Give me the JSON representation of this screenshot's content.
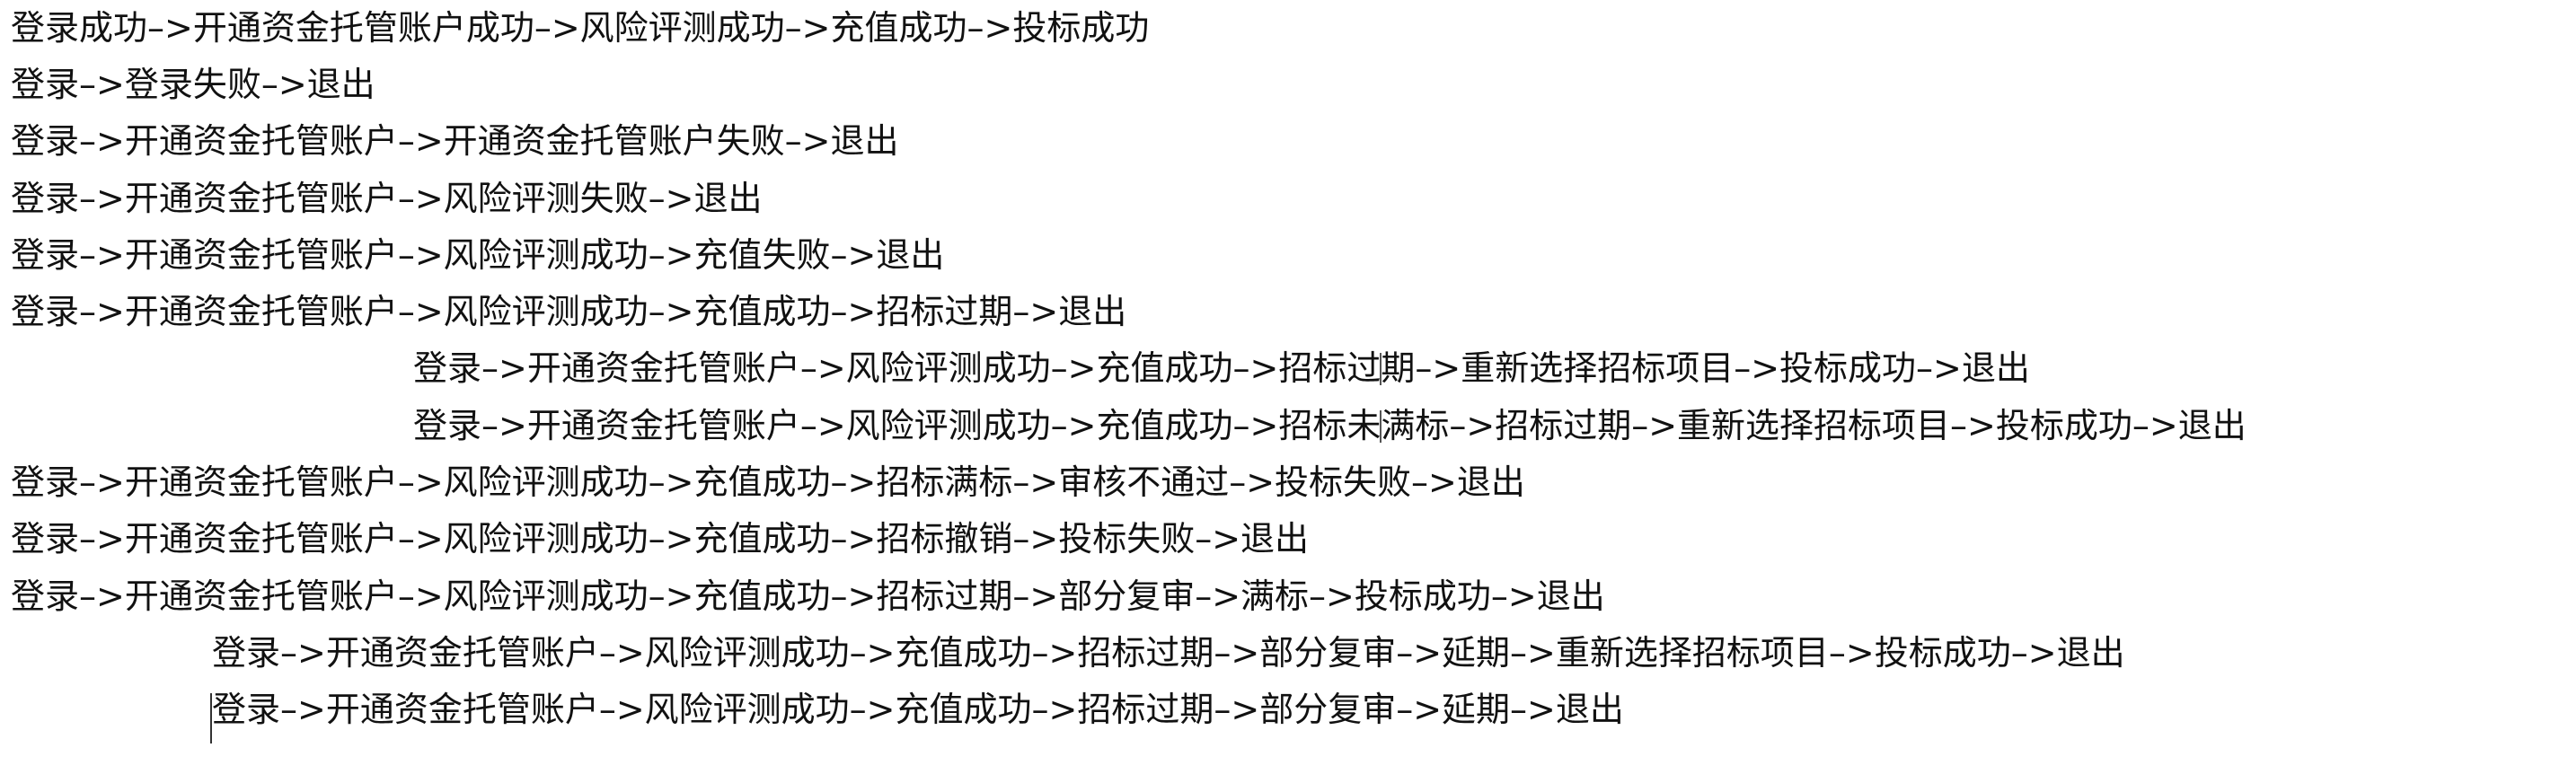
{
  "lines": [
    "登录成功–>开通资金托管账户成功–>风险评测成功–>充值成功–>投标成功",
    "登录–>登录失败–>退出",
    "登录–>开通资金托管账户–>开通资金托管账户失败–>退出",
    "登录–>开通资金托管账户–>风险评测失败–>退出",
    "登录–>开通资金托管账户–>风险评测成功–>充值失败–>退出",
    "登录–>开通资金托管账户–>风险评测成功–>充值成功–>招标过期–>退出",
    "登录–>开通资金托管账户–>风险评测成功–>充值成功–>招标过期–>重新选择招标项目–>投标成功–>退出",
    "登录–>开通资金托管账户–>风险评测成功–>充值成功–>招标未满标–>招标过期–>重新选择招标项目–>投标成功–>退出",
    "登录–>开通资金托管账户–>风险评测成功–>充值成功–>招标满标–>审核不通过–>投标失败–>退出",
    "登录–>开通资金托管账户–>风险评测成功–>充值成功–>招标撤销–>投标失败–>退出",
    "登录–>开通资金托管账户–>风险评测成功–>充值成功–>招标过期–>部分复审–>满标–>投标成功–>退出",
    "登录–>开通资金托管账户–>风险评测成功–>充值成功–>招标过期–>部分复审–>延期–>重新选择招标项目–>投标成功–>退出",
    "登录–>开通资金托管账户–>风险评测成功–>充值成功–>招标过期–>部分复审–>延期–>退出"
  ]
}
